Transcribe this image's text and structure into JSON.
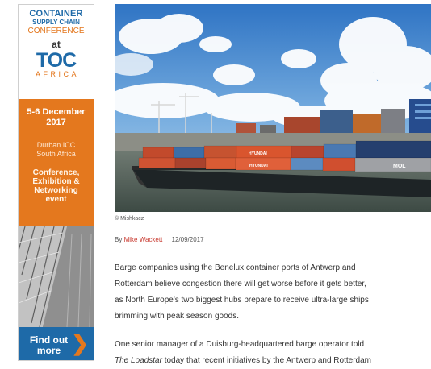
{
  "ad": {
    "line1": "CONTAINER",
    "line2": "SUPPLY CHAIN",
    "line3": "CONFERENCE",
    "at": "at",
    "logo": "TOC",
    "region": "AFRICA",
    "date_line1": "5-6 December",
    "date_line2": "2017",
    "venue_line1": "Durban ICC",
    "venue_line2": "South Africa",
    "event_lines": [
      "Conference,",
      "Exhibition &",
      "Networking",
      "event"
    ],
    "cta_line1": "Find out",
    "cta_line2": "more",
    "cta_icon": "chevron-right-icon",
    "colors": {
      "blue": "#1e6aa8",
      "orange": "#e4781e"
    }
  },
  "photo": {
    "credit": "© Mishkacz",
    "container_labels": [
      "HYUNDAI",
      "HYUNDAI",
      "MOL"
    ]
  },
  "byline": {
    "prefix": "By",
    "author": "Mike Wackett",
    "date": "12/09/2017",
    "author_color": "#c8372d"
  },
  "article": {
    "p1_lines": [
      "Barge companies using the Benelux container ports of Antwerp and",
      "Rotterdam believe congestion there will get worse before it gets better,",
      "as North Europe's two biggest hubs prepare to receive ultra-large ships",
      "brimming with peak season goods."
    ],
    "p2_line1": "One senior manager of a Duisburg-headquartered barge operator told",
    "p2_line2_italic": "The Loadstar",
    "p2_line2_rest": " today that recent initiatives by the Antwerp and Rotterdam"
  }
}
